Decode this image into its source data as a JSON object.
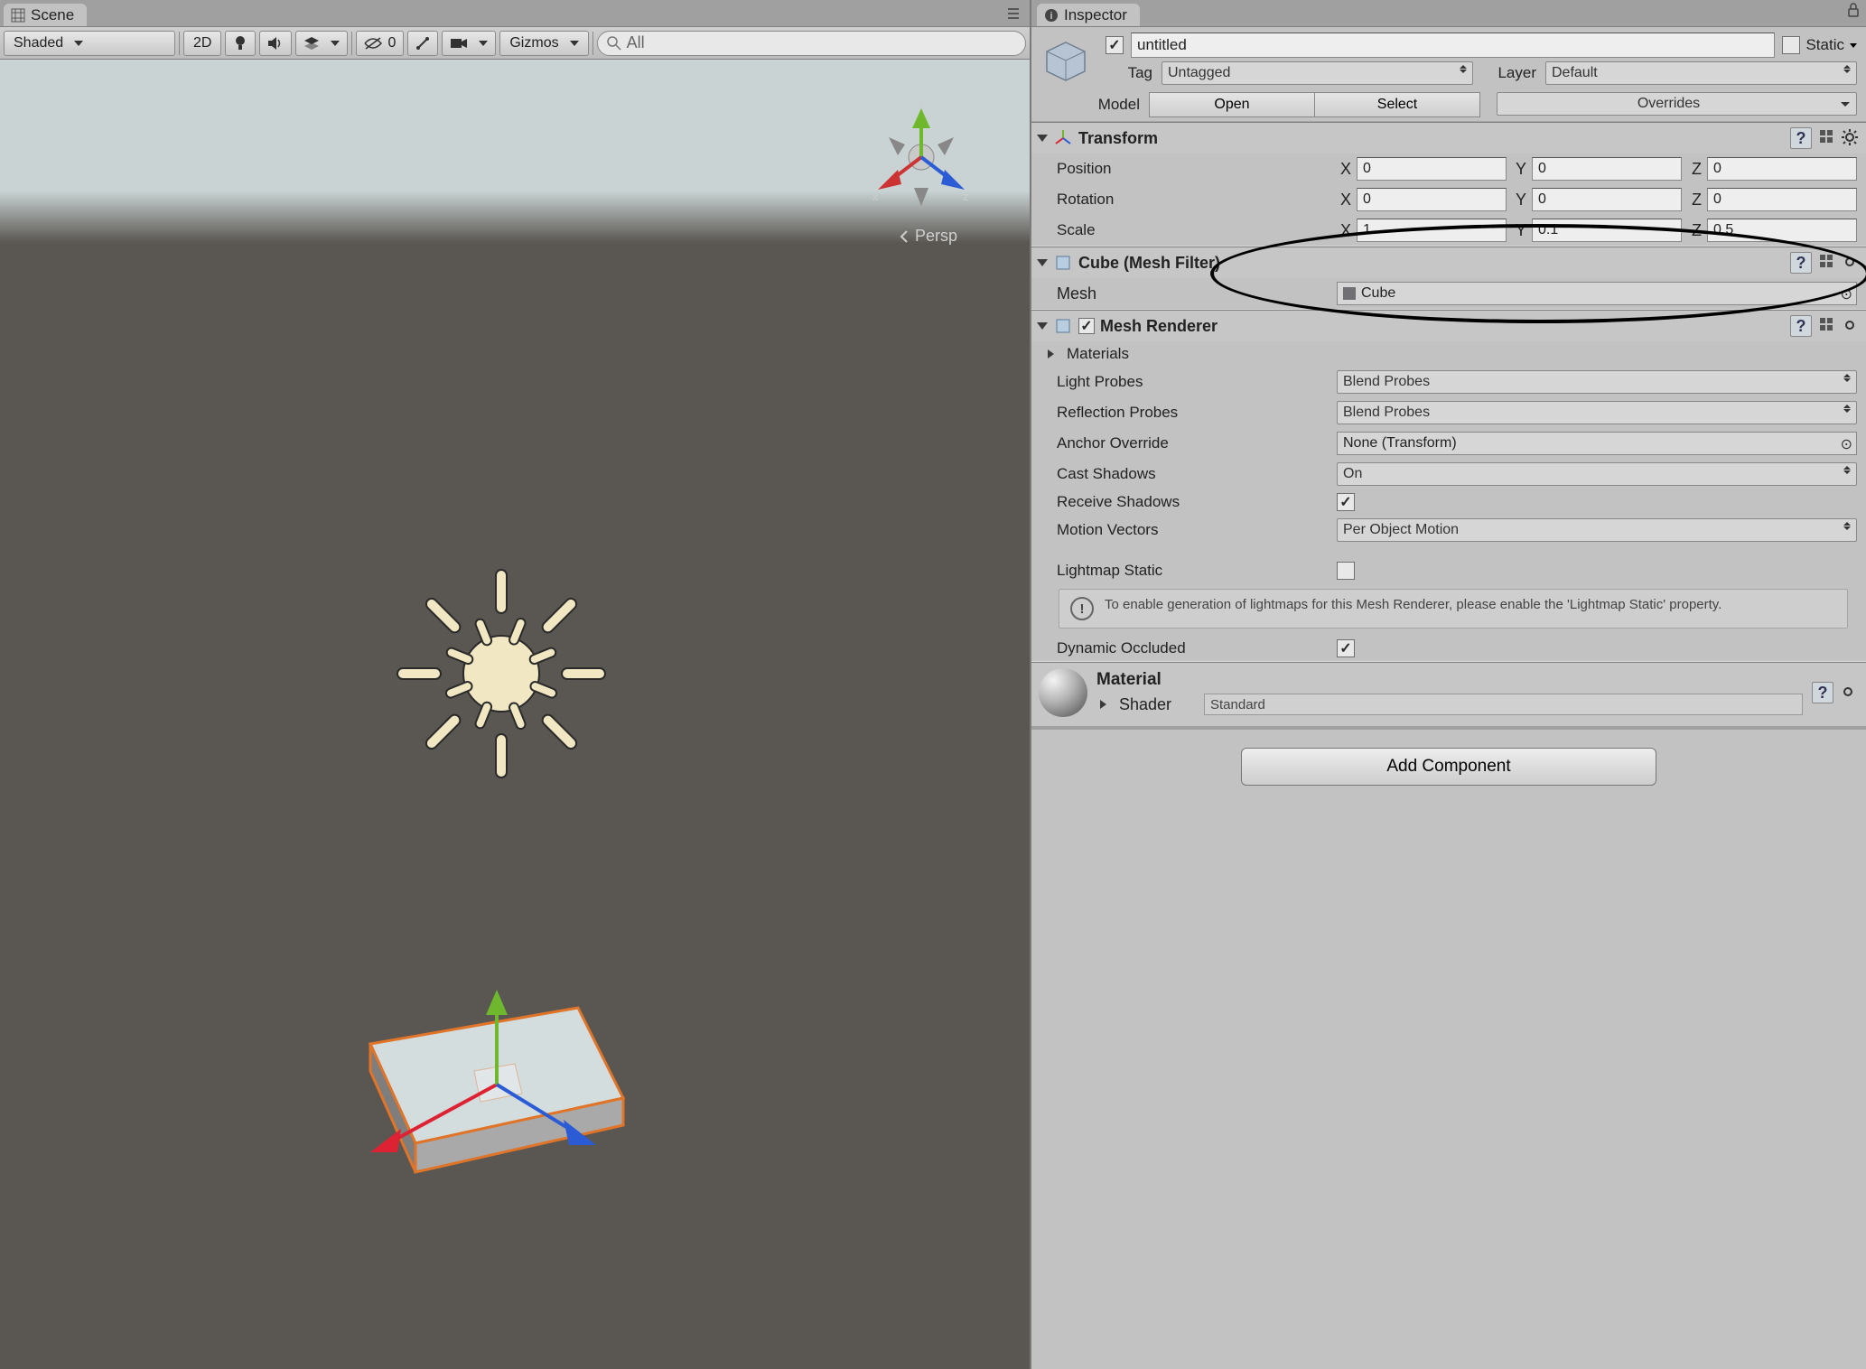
{
  "scene": {
    "tab_label": "Scene",
    "shading_mode": "Shaded",
    "btn_2d": "2D",
    "gizmos_label": "Gizmos",
    "vis_count": "0",
    "search_placeholder": "All",
    "camera_label": "Persp",
    "gizmo_axes": {
      "x": "x",
      "y": "y",
      "z": "z"
    }
  },
  "inspector": {
    "tab_label": "Inspector",
    "name": "untitled",
    "static_label": "Static",
    "tag_label": "Tag",
    "tag_value": "Untagged",
    "layer_label": "Layer",
    "layer_value": "Default",
    "model_label": "Model",
    "open_btn": "Open",
    "select_btn": "Select",
    "overrides_btn": "Overrides"
  },
  "transform": {
    "title": "Transform",
    "position_label": "Position",
    "rotation_label": "Rotation",
    "scale_label": "Scale",
    "position": {
      "x": "0",
      "y": "0",
      "z": "0"
    },
    "rotation": {
      "x": "0",
      "y": "0",
      "z": "0"
    },
    "scale": {
      "x": "1",
      "y": "0.1",
      "z": "0.5"
    }
  },
  "meshfilter": {
    "title": "Cube (Mesh Filter)",
    "mesh_label": "Mesh",
    "mesh_value": "Cube"
  },
  "renderer": {
    "title": "Mesh Renderer",
    "materials_label": "Materials",
    "light_probes_label": "Light Probes",
    "light_probes_value": "Blend Probes",
    "reflection_probes_label": "Reflection Probes",
    "reflection_probes_value": "Blend Probes",
    "anchor_override_label": "Anchor Override",
    "anchor_override_value": "None (Transform)",
    "cast_shadows_label": "Cast Shadows",
    "cast_shadows_value": "On",
    "receive_shadows_label": "Receive Shadows",
    "motion_vectors_label": "Motion Vectors",
    "motion_vectors_value": "Per Object Motion",
    "lightmap_static_label": "Lightmap Static",
    "lightmap_hint": "To enable generation of lightmaps for this Mesh Renderer, please enable the 'Lightmap Static' property.",
    "dynamic_occluded_label": "Dynamic Occluded"
  },
  "material": {
    "title": "Material",
    "shader_label": "Shader",
    "shader_value": "Standard"
  },
  "add_component": "Add Component"
}
